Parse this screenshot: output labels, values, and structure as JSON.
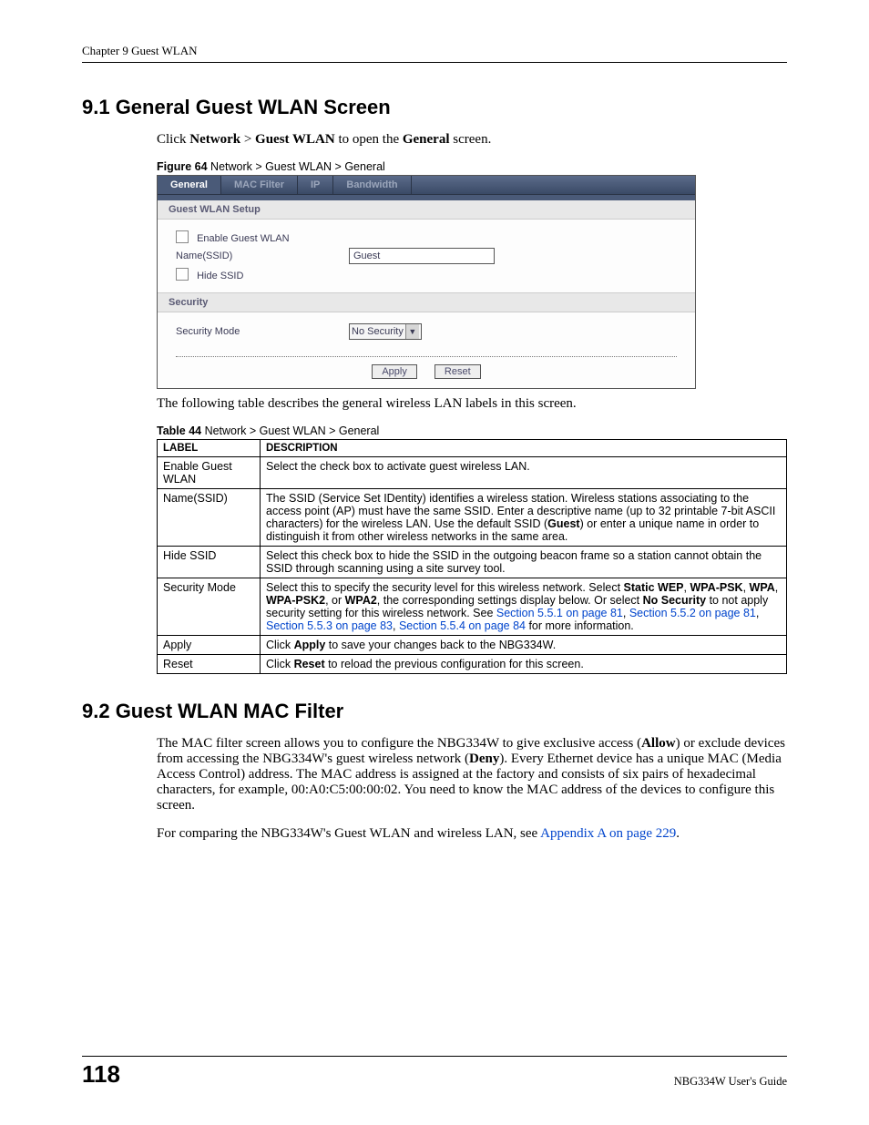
{
  "chapterHeader": "Chapter 9 Guest WLAN",
  "section91": {
    "heading": "9.1  General Guest WLAN Screen",
    "intro_pre": "Click ",
    "intro_b1": "Network",
    "intro_gt": " > ",
    "intro_b2": "Guest WLAN",
    "intro_mid": " to open the ",
    "intro_b3": "General",
    "intro_post": " screen."
  },
  "figure64": {
    "captionBold": "Figure 64",
    "captionRest": "   Network > Guest WLAN > General",
    "tabs": {
      "general": "General",
      "macFilter": "MAC Filter",
      "ip": "IP",
      "bandwidth": "Bandwidth"
    },
    "guestSetupTitle": "Guest WLAN Setup",
    "enableGuest": "Enable Guest WLAN",
    "nameSsidLabel": "Name(SSID)",
    "nameSsidValue": "Guest",
    "hideSsid": "Hide SSID",
    "securityTitle": "Security",
    "securityModeLabel": "Security Mode",
    "securityModeValue": "No Security",
    "apply": "Apply",
    "reset": "Reset"
  },
  "tableIntro": "The following table describes the general wireless LAN labels in this screen.",
  "table44": {
    "captionBold": "Table 44",
    "captionRest": "   Network > Guest WLAN > General",
    "hLabel": "LABEL",
    "hDesc": "DESCRIPTION",
    "rows": {
      "r0_label": "Enable Guest WLAN",
      "r0_desc": "Select the check box to activate guest wireless LAN.",
      "r1_label": "Name(SSID)",
      "r1_desc_a": "The SSID (Service Set IDentity) identifies a wireless station. Wireless stations associating to the access point (AP) must have the same SSID. Enter a descriptive name (up to 32 printable 7-bit ASCII characters) for the wireless LAN. Use the default SSID (",
      "r1_desc_b": "Guest",
      "r1_desc_c": ") or enter a unique name in order to distinguish it from other wireless networks in the same area.",
      "r2_label": "Hide SSID",
      "r2_desc": "Select this check box to hide the SSID in the outgoing beacon frame so a station cannot obtain the SSID through scanning using a site survey tool.",
      "r3_label": "Security Mode",
      "r3_pre": "Select this to specify the security level for this wireless network. Select ",
      "r3_b1": "Static WEP",
      "r3_sep1": ", ",
      "r3_b2": "WPA-PSK",
      "r3_sep2": ", ",
      "r3_b3": "WPA",
      "r3_sep3": ", ",
      "r3_b4": "WPA-PSK2",
      "r3_sep4": ", or ",
      "r3_b5": "WPA2",
      "r3_mid1": ", the corresponding settings display below. Or select ",
      "r3_b6": "No Security",
      "r3_mid2": " to not apply security setting for this wireless network. See ",
      "r3_link1": "Section 5.5.1 on page 81",
      "r3_sep5": ", ",
      "r3_link2": "Section 5.5.2 on page 81",
      "r3_sep6": ", ",
      "r3_link3": "Section 5.5.3 on page 83",
      "r3_sep7": ", ",
      "r3_link4": "Section 5.5.4 on page 84",
      "r3_post": " for more information.",
      "r4_label": "Apply",
      "r4_pre": "Click ",
      "r4_b": "Apply",
      "r4_post": " to save your changes back to the NBG334W.",
      "r5_label": "Reset",
      "r5_pre": "Click ",
      "r5_b": "Reset",
      "r5_post": " to reload the previous configuration for this screen."
    }
  },
  "section92": {
    "heading": "9.2  Guest WLAN MAC Filter",
    "p1a": "The MAC filter screen allows you to configure the NBG334W to give exclusive access (",
    "p1b1": "Allow",
    "p1b": ") or exclude devices from accessing the NBG334W's guest wireless network (",
    "p1b2": "Deny",
    "p1c": "). Every Ethernet device has a unique MAC (Media Access Control) address. The MAC address is assigned at the factory and consists of six pairs of hexadecimal characters, for example, 00:A0:C5:00:00:02. You need to know the MAC address of the devices to configure this screen.",
    "p2a": "For comparing the NBG334W's Guest WLAN and wireless LAN, see ",
    "p2link": "Appendix A on page 229",
    "p2b": "."
  },
  "footer": {
    "pageNum": "118",
    "guide": "NBG334W User's Guide"
  }
}
